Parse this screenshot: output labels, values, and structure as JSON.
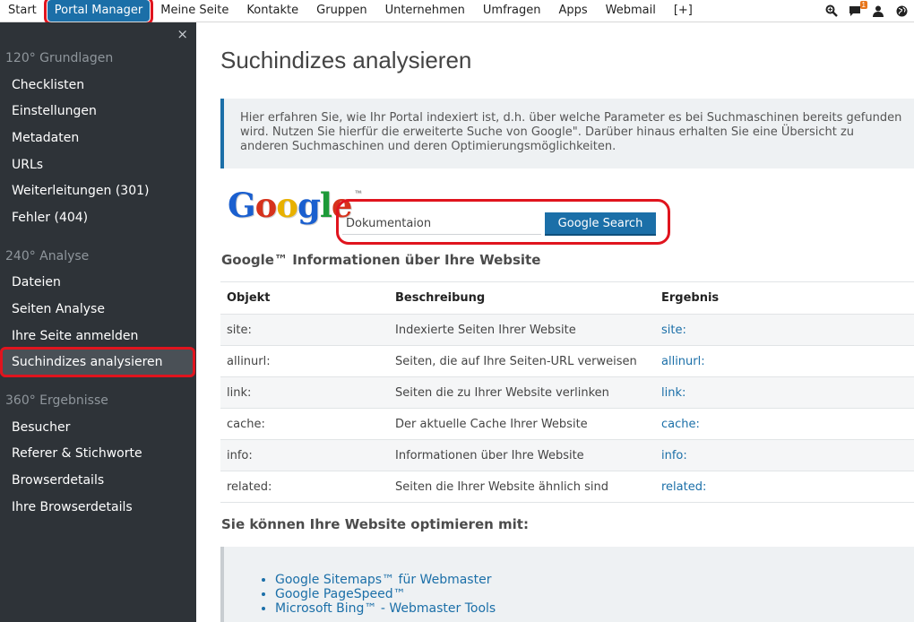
{
  "topnav": {
    "items": [
      "Start",
      "Portal Manager",
      "Meine Seite",
      "Kontakte",
      "Gruppen",
      "Unternehmen",
      "Umfragen",
      "Apps",
      "Webmail",
      "[+]"
    ],
    "active": "Portal Manager",
    "notification_count": "1"
  },
  "sidebar": {
    "close": "×",
    "sections": [
      {
        "title": "120° Grundlagen",
        "items": [
          "Checklisten",
          "Einstellungen",
          "Metadaten",
          "URLs",
          "Weiterleitungen (301)",
          "Fehler (404)"
        ]
      },
      {
        "title": "240° Analyse",
        "items": [
          "Dateien",
          "Seiten Analyse",
          "Ihre Seite anmelden",
          "Suchindizes analysieren"
        ]
      },
      {
        "title": "360° Ergebnisse",
        "items": [
          "Besucher",
          "Referer & Stichworte",
          "Browserdetails",
          "Ihre Browserdetails"
        ]
      }
    ],
    "selected": "Suchindizes analysieren"
  },
  "main": {
    "title": "Suchindizes analysieren",
    "info": "Hier erfahren Sie, wie Ihr Portal indexiert ist, d.h. über welche Parameter es bei Suchmaschinen bereits gefunden wird. Nutzen Sie hierfür die erweiterte Suche von Google\". Darüber hinaus erhalten Sie eine Übersicht zu anderen Suchmaschinen und deren Optimierungsmöglichkeiten.",
    "google_logo": "Google",
    "search": {
      "value": "Dokumentaion",
      "button": "Google Search"
    },
    "info_heading": "Google™ Informationen über Ihre Website",
    "table": {
      "headers": [
        "Objekt",
        "Beschreibung",
        "Ergebnis"
      ],
      "rows": [
        [
          "site:",
          "Indexierte Seiten Ihrer Website",
          "site:"
        ],
        [
          "allinurl:",
          "Seiten, die auf Ihre Seiten-URL verweisen",
          "allinurl:"
        ],
        [
          "link:",
          "Seiten die zu Ihrer Website verlinken",
          "link:"
        ],
        [
          "cache:",
          "Der aktuelle Cache Ihrer Website",
          "cache:"
        ],
        [
          "info:",
          "Informationen über Ihre Website",
          "info:"
        ],
        [
          "related:",
          "Seiten die Ihrer Website ähnlich sind",
          "related:"
        ]
      ]
    },
    "optimize_heading": "Sie können Ihre Website optimieren mit:",
    "optimize_links": [
      "Google Sitemaps™ für Webmaster",
      "Google PageSpeed™",
      "Microsoft Bing™ - Webmaster Tools"
    ]
  },
  "colors": {
    "accent": "#1b6fa8",
    "sidebar_bg": "#2e3338",
    "highlight_ring": "#e0141e",
    "badge": "#e8751a"
  }
}
